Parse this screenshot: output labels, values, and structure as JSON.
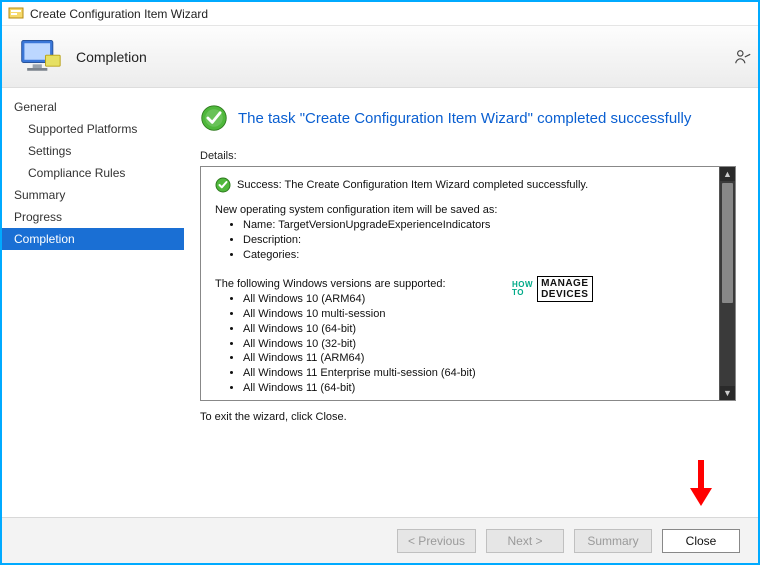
{
  "window": {
    "title": "Create Configuration Item Wizard"
  },
  "banner": {
    "title": "Completion"
  },
  "sidebar": {
    "items": [
      {
        "label": "General",
        "child": false,
        "selected": false
      },
      {
        "label": "Supported Platforms",
        "child": true,
        "selected": false
      },
      {
        "label": "Settings",
        "child": true,
        "selected": false
      },
      {
        "label": "Compliance Rules",
        "child": true,
        "selected": false
      },
      {
        "label": "Summary",
        "child": false,
        "selected": false
      },
      {
        "label": "Progress",
        "child": false,
        "selected": false
      },
      {
        "label": "Completion",
        "child": false,
        "selected": true
      }
    ]
  },
  "main": {
    "headingText": "The task \"Create Configuration Item Wizard\" completed successfully",
    "detailsLabel": "Details:",
    "successLine": "Success: The Create Configuration Item Wizard completed successfully.",
    "savedAsLine": "New operating system configuration item will be saved as:",
    "savedAs": {
      "name": "Name: TargetVersionUpgradeExperienceIndicators",
      "description": "Description:",
      "categories": "Categories:"
    },
    "supportedHeader": "The following Windows versions are supported:",
    "supportedList": [
      "All Windows 10 (ARM64)",
      "All Windows 10 multi-session",
      "All Windows 10 (64-bit)",
      "All Windows 10 (32-bit)",
      "All Windows 11 (ARM64)",
      "All Windows 11 Enterprise multi-session (64-bit)",
      "All Windows 11 (64-bit)"
    ],
    "exitHint": "To exit the wizard, click Close."
  },
  "footer": {
    "previous": "< Previous",
    "next": "Next >",
    "summary": "Summary",
    "close": "Close"
  }
}
